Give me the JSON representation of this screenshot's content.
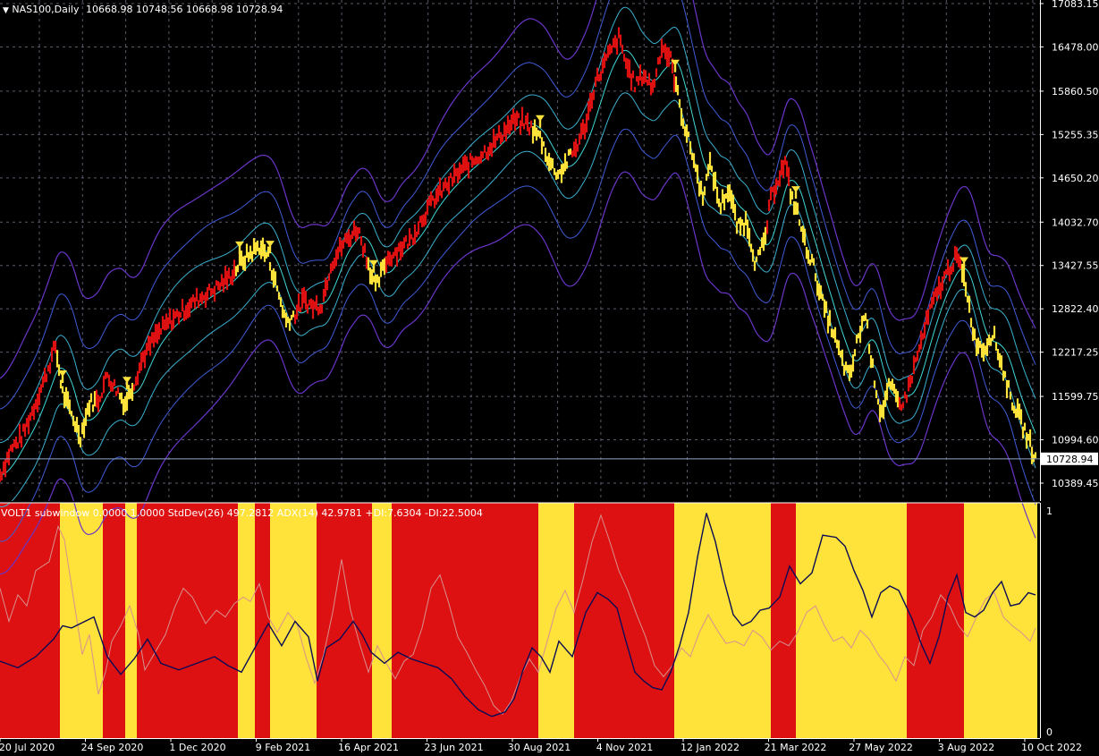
{
  "header": {
    "symbol": "NAS100,Daily",
    "ohlc": "10668.98 10748.56 10668.98 10728.94"
  },
  "subwindow": {
    "label": "VOLT1 subwindow 0.0000 1.0000  StdDev(26) 497.2812  ADX(14) 42.9781  +DI:7.6304 -DI:22.5004",
    "scale_top": "1",
    "scale_bottom": "0"
  },
  "colors": {
    "background": "#000000",
    "bull": "#dd1111",
    "bear": "#ffe33a",
    "arrow": "#ffe33a",
    "grid": "#5a5a6a",
    "band_outer": "#6a35c8",
    "band_mid": "#3f5bd8",
    "band_inner": "#3ab0d0",
    "center": "#40d8d8",
    "adx_line": "#0b0b55",
    "di_line": "#d89090",
    "current_price_line": "#8fa5c8"
  },
  "chart_data": {
    "type": "line",
    "title": "NAS100,Daily",
    "xlabel": "",
    "ylabel": "",
    "ylim": [
      10130,
      17083
    ],
    "current_price": 10728.94,
    "current_price_label": "10728.94",
    "y_ticks": [
      {
        "value": 17083.15,
        "label": "17083.15"
      },
      {
        "value": 16478.0,
        "label": "16478.00"
      },
      {
        "value": 15860.5,
        "label": "15860.50"
      },
      {
        "value": 15255.35,
        "label": "15255.35"
      },
      {
        "value": 14650.2,
        "label": "14650.20"
      },
      {
        "value": 14032.7,
        "label": "14032.70"
      },
      {
        "value": 13427.55,
        "label": "13427.55"
      },
      {
        "value": 12822.4,
        "label": "12822.40"
      },
      {
        "value": 12217.25,
        "label": "12217.25"
      },
      {
        "value": 11599.75,
        "label": "11599.75"
      },
      {
        "value": 10994.6,
        "label": "10994.60"
      },
      {
        "value": 10389.45,
        "label": "10389.45"
      }
    ],
    "x_ticks": [
      "20 Jul 2020",
      "24 Sep 2020",
      "1 Dec 2020",
      "9 Feb 2021",
      "16 Apr 2021",
      "23 Jun 2021",
      "30 Aug 2021",
      "4 Nov 2021",
      "12 Jan 2022",
      "21 Mar 2022",
      "27 May 2022",
      "3 Aug 2022",
      "10 Oct 2022"
    ],
    "price_path": [
      [
        0,
        10500
      ],
      [
        12,
        10850
      ],
      [
        25,
        11050
      ],
      [
        38,
        11450
      ],
      [
        50,
        11850
      ],
      [
        62,
        12300
      ],
      [
        70,
        11650
      ],
      [
        80,
        11350
      ],
      [
        90,
        11050
      ],
      [
        100,
        11500
      ],
      [
        110,
        11550
      ],
      [
        120,
        11900
      ],
      [
        130,
        11700
      ],
      [
        140,
        11500
      ],
      [
        150,
        11800
      ],
      [
        160,
        12150
      ],
      [
        175,
        12450
      ],
      [
        190,
        12650
      ],
      [
        205,
        12800
      ],
      [
        220,
        12950
      ],
      [
        240,
        13100
      ],
      [
        255,
        13250
      ],
      [
        268,
        13450
      ],
      [
        280,
        13600
      ],
      [
        290,
        13700
      ],
      [
        300,
        13550
      ],
      [
        310,
        13100
      ],
      [
        320,
        12650
      ],
      [
        330,
        12750
      ],
      [
        340,
        12950
      ],
      [
        350,
        12850
      ],
      [
        360,
        12900
      ],
      [
        370,
        13450
      ],
      [
        385,
        13750
      ],
      [
        400,
        13950
      ],
      [
        410,
        13550
      ],
      [
        420,
        13100
      ],
      [
        432,
        13500
      ],
      [
        445,
        13650
      ],
      [
        460,
        13800
      ],
      [
        470,
        14050
      ],
      [
        485,
        14350
      ],
      [
        500,
        14550
      ],
      [
        515,
        14750
      ],
      [
        530,
        14900
      ],
      [
        545,
        15050
      ],
      [
        560,
        15250
      ],
      [
        575,
        15450
      ],
      [
        590,
        15400
      ],
      [
        605,
        15200
      ],
      [
        615,
        14850
      ],
      [
        625,
        14700
      ],
      [
        635,
        14900
      ],
      [
        645,
        15100
      ],
      [
        655,
        15400
      ],
      [
        665,
        15950
      ],
      [
        680,
        16350
      ],
      [
        692,
        16600
      ],
      [
        700,
        16250
      ],
      [
        710,
        15950
      ],
      [
        720,
        16100
      ],
      [
        730,
        15900
      ],
      [
        740,
        16500
      ],
      [
        750,
        16300
      ],
      [
        758,
        15800
      ],
      [
        765,
        15400
      ],
      [
        775,
        14950
      ],
      [
        785,
        14400
      ],
      [
        795,
        14850
      ],
      [
        805,
        14250
      ],
      [
        815,
        14500
      ],
      [
        825,
        13950
      ],
      [
        835,
        14050
      ],
      [
        845,
        13450
      ],
      [
        855,
        13750
      ],
      [
        862,
        14350
      ],
      [
        870,
        14650
      ],
      [
        878,
        14850
      ],
      [
        885,
        14400
      ],
      [
        892,
        14150
      ],
      [
        900,
        13750
      ],
      [
        910,
        13400
      ],
      [
        920,
        12900
      ],
      [
        930,
        12550
      ],
      [
        940,
        12150
      ],
      [
        950,
        11850
      ],
      [
        960,
        12450
      ],
      [
        968,
        12750
      ],
      [
        975,
        12050
      ],
      [
        985,
        11350
      ],
      [
        995,
        11750
      ],
      [
        1005,
        11500
      ],
      [
        1012,
        11550
      ],
      [
        1020,
        11900
      ],
      [
        1030,
        12350
      ],
      [
        1040,
        12800
      ],
      [
        1050,
        13100
      ],
      [
        1060,
        13350
      ],
      [
        1070,
        13550
      ],
      [
        1080,
        13150
      ],
      [
        1090,
        12400
      ],
      [
        1100,
        12250
      ],
      [
        1110,
        12500
      ],
      [
        1120,
        12050
      ],
      [
        1130,
        11600
      ],
      [
        1140,
        11300
      ],
      [
        1150,
        11000
      ],
      [
        1158,
        10729
      ]
    ],
    "red_segments": [
      [
        0,
        62
      ],
      [
        108,
        132
      ],
      [
        150,
        262
      ],
      [
        330,
        360
      ],
      [
        360,
        410
      ],
      [
        432,
        595
      ],
      [
        640,
        755
      ],
      [
        858,
        882
      ],
      [
        1005,
        1075
      ]
    ],
    "sell_arrows": [
      70,
      142,
      268,
      302,
      418,
      604,
      755,
      890,
      1078
    ],
    "bands": [
      {
        "name": "outer-upper",
        "offset": 1350,
        "color": "#6a35c8",
        "width": 1.2
      },
      {
        "name": "mid-upper",
        "offset": 850,
        "color": "#3f5bd8",
        "width": 1.0
      },
      {
        "name": "inner-upper",
        "offset": 420,
        "color": "#3ab0d0",
        "width": 1.0
      },
      {
        "name": "center",
        "offset": 0,
        "color": "#40d8d8",
        "width": 1.0
      },
      {
        "name": "inner-lower",
        "offset": -420,
        "color": "#3ab0d0",
        "width": 1.0
      },
      {
        "name": "mid-lower",
        "offset": -850,
        "color": "#3f5bd8",
        "width": 1.0
      },
      {
        "name": "outer-lower",
        "offset": -1350,
        "color": "#6a35c8",
        "width": 1.2
      }
    ],
    "regime_blocks": [
      {
        "start": 0,
        "end": 67,
        "regime": "red"
      },
      {
        "start": 67,
        "end": 115,
        "regime": "yellow"
      },
      {
        "start": 115,
        "end": 140,
        "regime": "red"
      },
      {
        "start": 140,
        "end": 153,
        "regime": "yellow"
      },
      {
        "start": 153,
        "end": 266,
        "regime": "red"
      },
      {
        "start": 266,
        "end": 285,
        "regime": "yellow"
      },
      {
        "start": 285,
        "end": 302,
        "regime": "red"
      },
      {
        "start": 302,
        "end": 354,
        "regime": "yellow"
      },
      {
        "start": 354,
        "end": 416,
        "regime": "red"
      },
      {
        "start": 416,
        "end": 438,
        "regime": "yellow"
      },
      {
        "start": 438,
        "end": 602,
        "regime": "red"
      },
      {
        "start": 602,
        "end": 642,
        "regime": "yellow"
      },
      {
        "start": 642,
        "end": 754,
        "regime": "red"
      },
      {
        "start": 754,
        "end": 862,
        "regime": "yellow"
      },
      {
        "start": 862,
        "end": 890,
        "regime": "red"
      },
      {
        "start": 890,
        "end": 1014,
        "regime": "yellow"
      },
      {
        "start": 1014,
        "end": 1078,
        "regime": "red"
      },
      {
        "start": 1078,
        "end": 1160,
        "regime": "yellow"
      }
    ],
    "adx_series": [
      [
        0,
        0.32
      ],
      [
        20,
        0.29
      ],
      [
        40,
        0.34
      ],
      [
        60,
        0.42
      ],
      [
        70,
        0.48
      ],
      [
        80,
        0.47
      ],
      [
        95,
        0.5
      ],
      [
        105,
        0.52
      ],
      [
        120,
        0.34
      ],
      [
        135,
        0.26
      ],
      [
        150,
        0.33
      ],
      [
        165,
        0.42
      ],
      [
        180,
        0.31
      ],
      [
        200,
        0.28
      ],
      [
        220,
        0.31
      ],
      [
        240,
        0.34
      ],
      [
        255,
        0.3
      ],
      [
        270,
        0.27
      ],
      [
        285,
        0.38
      ],
      [
        300,
        0.49
      ],
      [
        315,
        0.39
      ],
      [
        330,
        0.5
      ],
      [
        345,
        0.43
      ],
      [
        355,
        0.23
      ],
      [
        365,
        0.38
      ],
      [
        380,
        0.42
      ],
      [
        395,
        0.5
      ],
      [
        405,
        0.44
      ],
      [
        415,
        0.36
      ],
      [
        430,
        0.31
      ],
      [
        445,
        0.36
      ],
      [
        460,
        0.33
      ],
      [
        475,
        0.31
      ],
      [
        490,
        0.29
      ],
      [
        505,
        0.24
      ],
      [
        520,
        0.16
      ],
      [
        535,
        0.1
      ],
      [
        550,
        0.07
      ],
      [
        565,
        0.09
      ],
      [
        575,
        0.15
      ],
      [
        585,
        0.28
      ],
      [
        595,
        0.38
      ],
      [
        605,
        0.34
      ],
      [
        615,
        0.27
      ],
      [
        625,
        0.41
      ],
      [
        640,
        0.34
      ],
      [
        655,
        0.54
      ],
      [
        668,
        0.63
      ],
      [
        680,
        0.6
      ],
      [
        690,
        0.56
      ],
      [
        700,
        0.41
      ],
      [
        710,
        0.27
      ],
      [
        720,
        0.23
      ],
      [
        730,
        0.2
      ],
      [
        740,
        0.19
      ],
      [
        750,
        0.27
      ],
      [
        760,
        0.39
      ],
      [
        770,
        0.54
      ],
      [
        780,
        0.79
      ],
      [
        790,
        0.99
      ],
      [
        800,
        0.86
      ],
      [
        810,
        0.68
      ],
      [
        820,
        0.53
      ],
      [
        830,
        0.48
      ],
      [
        840,
        0.5
      ],
      [
        850,
        0.55
      ],
      [
        860,
        0.56
      ],
      [
        872,
        0.61
      ],
      [
        883,
        0.75
      ],
      [
        895,
        0.67
      ],
      [
        908,
        0.72
      ],
      [
        920,
        0.89
      ],
      [
        935,
        0.88
      ],
      [
        945,
        0.84
      ],
      [
        955,
        0.73
      ],
      [
        965,
        0.64
      ],
      [
        975,
        0.52
      ],
      [
        985,
        0.63
      ],
      [
        995,
        0.66
      ],
      [
        1005,
        0.64
      ],
      [
        1020,
        0.51
      ],
      [
        1030,
        0.4
      ],
      [
        1040,
        0.31
      ],
      [
        1050,
        0.43
      ],
      [
        1060,
        0.61
      ],
      [
        1070,
        0.71
      ],
      [
        1080,
        0.54
      ],
      [
        1090,
        0.52
      ],
      [
        1100,
        0.55
      ],
      [
        1110,
        0.63
      ],
      [
        1120,
        0.68
      ],
      [
        1130,
        0.57
      ],
      [
        1140,
        0.58
      ],
      [
        1150,
        0.63
      ],
      [
        1158,
        0.62
      ]
    ],
    "di_series": [
      [
        0,
        0.65
      ],
      [
        10,
        0.5
      ],
      [
        20,
        0.62
      ],
      [
        30,
        0.57
      ],
      [
        40,
        0.73
      ],
      [
        55,
        0.77
      ],
      [
        65,
        0.93
      ],
      [
        72,
        0.87
      ],
      [
        80,
        0.66
      ],
      [
        92,
        0.35
      ],
      [
        100,
        0.44
      ],
      [
        110,
        0.17
      ],
      [
        118,
        0.27
      ],
      [
        125,
        0.41
      ],
      [
        135,
        0.48
      ],
      [
        145,
        0.57
      ],
      [
        155,
        0.44
      ],
      [
        162,
        0.28
      ],
      [
        172,
        0.35
      ],
      [
        185,
        0.44
      ],
      [
        195,
        0.56
      ],
      [
        205,
        0.65
      ],
      [
        215,
        0.61
      ],
      [
        230,
        0.49
      ],
      [
        242,
        0.55
      ],
      [
        252,
        0.52
      ],
      [
        262,
        0.58
      ],
      [
        272,
        0.61
      ],
      [
        280,
        0.59
      ],
      [
        290,
        0.67
      ],
      [
        300,
        0.52
      ],
      [
        310,
        0.45
      ],
      [
        322,
        0.54
      ],
      [
        332,
        0.49
      ],
      [
        342,
        0.34
      ],
      [
        352,
        0.22
      ],
      [
        362,
        0.35
      ],
      [
        372,
        0.54
      ],
      [
        382,
        0.78
      ],
      [
        392,
        0.55
      ],
      [
        402,
        0.4
      ],
      [
        412,
        0.27
      ],
      [
        422,
        0.39
      ],
      [
        432,
        0.31
      ],
      [
        442,
        0.24
      ],
      [
        452,
        0.32
      ],
      [
        462,
        0.35
      ],
      [
        472,
        0.47
      ],
      [
        482,
        0.65
      ],
      [
        492,
        0.71
      ],
      [
        502,
        0.58
      ],
      [
        512,
        0.43
      ],
      [
        522,
        0.36
      ],
      [
        532,
        0.28
      ],
      [
        542,
        0.21
      ],
      [
        552,
        0.12
      ],
      [
        562,
        0.08
      ],
      [
        572,
        0.14
      ],
      [
        582,
        0.25
      ],
      [
        592,
        0.33
      ],
      [
        602,
        0.27
      ],
      [
        612,
        0.41
      ],
      [
        622,
        0.56
      ],
      [
        632,
        0.64
      ],
      [
        642,
        0.54
      ],
      [
        652,
        0.69
      ],
      [
        662,
        0.86
      ],
      [
        672,
        0.98
      ],
      [
        682,
        0.86
      ],
      [
        692,
        0.73
      ],
      [
        702,
        0.64
      ],
      [
        712,
        0.53
      ],
      [
        722,
        0.43
      ],
      [
        732,
        0.3
      ],
      [
        742,
        0.25
      ],
      [
        752,
        0.3
      ],
      [
        762,
        0.38
      ],
      [
        772,
        0.34
      ],
      [
        782,
        0.45
      ],
      [
        792,
        0.53
      ],
      [
        802,
        0.46
      ],
      [
        812,
        0.4
      ],
      [
        822,
        0.41
      ],
      [
        832,
        0.39
      ],
      [
        842,
        0.46
      ],
      [
        852,
        0.43
      ],
      [
        862,
        0.37
      ],
      [
        872,
        0.41
      ],
      [
        882,
        0.39
      ],
      [
        892,
        0.45
      ],
      [
        902,
        0.54
      ],
      [
        912,
        0.57
      ],
      [
        922,
        0.48
      ],
      [
        932,
        0.41
      ],
      [
        942,
        0.43
      ],
      [
        952,
        0.38
      ],
      [
        962,
        0.46
      ],
      [
        972,
        0.42
      ],
      [
        982,
        0.35
      ],
      [
        992,
        0.3
      ],
      [
        1002,
        0.23
      ],
      [
        1012,
        0.34
      ],
      [
        1022,
        0.3
      ],
      [
        1032,
        0.46
      ],
      [
        1042,
        0.52
      ],
      [
        1052,
        0.62
      ],
      [
        1062,
        0.57
      ],
      [
        1072,
        0.48
      ],
      [
        1082,
        0.43
      ],
      [
        1092,
        0.52
      ],
      [
        1102,
        0.6
      ],
      [
        1112,
        0.63
      ],
      [
        1122,
        0.52
      ],
      [
        1132,
        0.48
      ],
      [
        1142,
        0.45
      ],
      [
        1152,
        0.41
      ],
      [
        1158,
        0.47
      ]
    ]
  }
}
